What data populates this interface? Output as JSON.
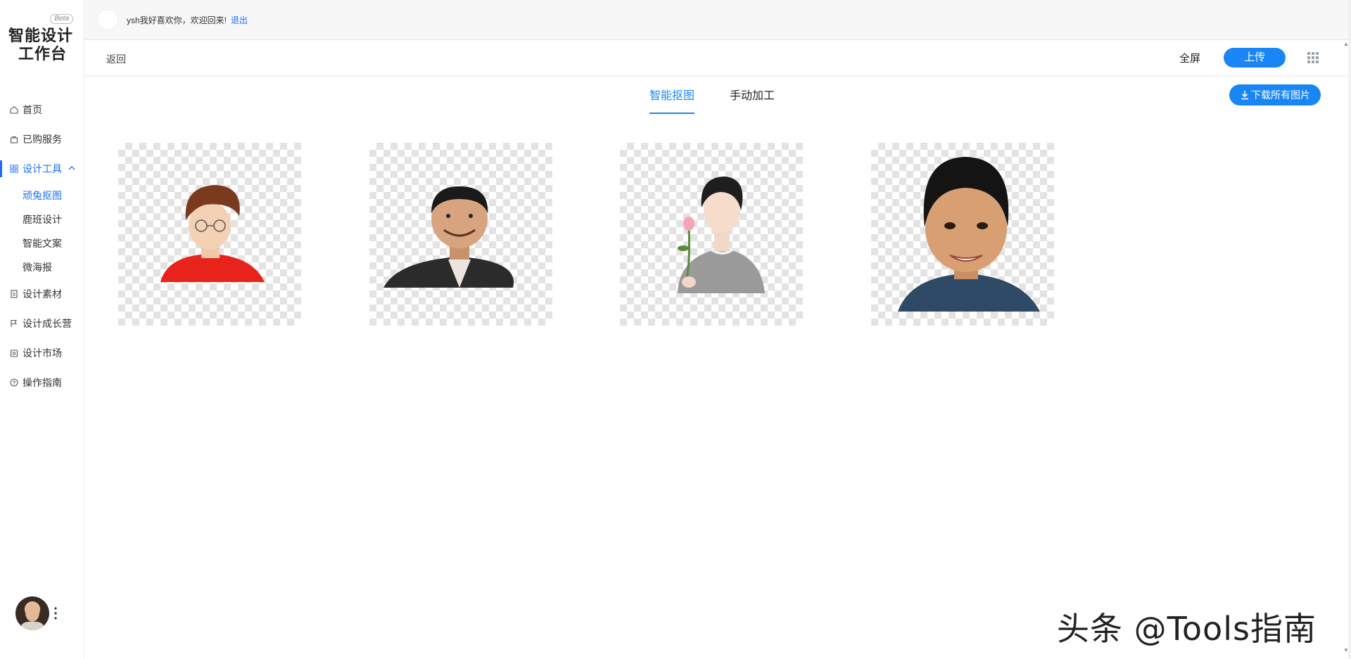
{
  "logo": {
    "beta": "Beta",
    "line1": "智能设计",
    "line2": "工作台"
  },
  "sidebar": {
    "items": [
      {
        "label": "首页",
        "icon": "home-icon"
      },
      {
        "label": "已购服务",
        "icon": "bag-icon"
      },
      {
        "label": "设计工具",
        "icon": "grid-icon",
        "active": true,
        "expanded": true,
        "children": [
          {
            "label": "顽兔抠图",
            "active": true
          },
          {
            "label": "鹿班设计"
          },
          {
            "label": "智能文案"
          },
          {
            "label": "微海报"
          }
        ]
      },
      {
        "label": "设计素材",
        "icon": "file-icon"
      },
      {
        "label": "设计成长营",
        "icon": "flag-icon"
      },
      {
        "label": "设计市场",
        "icon": "store-icon"
      },
      {
        "label": "操作指南",
        "icon": "help-icon"
      }
    ]
  },
  "topbar": {
    "greeting": "ysh我好喜欢你，欢迎回来!",
    "logout": "退出"
  },
  "toolbar": {
    "back": "返回",
    "fullscreen": "全屏",
    "upload": "上传"
  },
  "tabs": [
    {
      "label": "智能抠图",
      "active": true
    },
    {
      "label": "手动加工",
      "active": false
    }
  ],
  "download_all": "下载所有图片",
  "images": [
    {
      "subject": "boy-red-shirt-cap",
      "shirt_color": "#e8231c"
    },
    {
      "subject": "man-dark-jacket",
      "shirt_color": "#2b2b2b"
    },
    {
      "subject": "young-man-with-rose",
      "shirt_color": "#9a9a9a"
    },
    {
      "subject": "smiling-child",
      "shirt_color": "#2e4a66"
    }
  ],
  "watermark": "头条 @Tools指南",
  "colors": {
    "accent": "#1a86f5",
    "active_text": "#1a6ff5"
  }
}
